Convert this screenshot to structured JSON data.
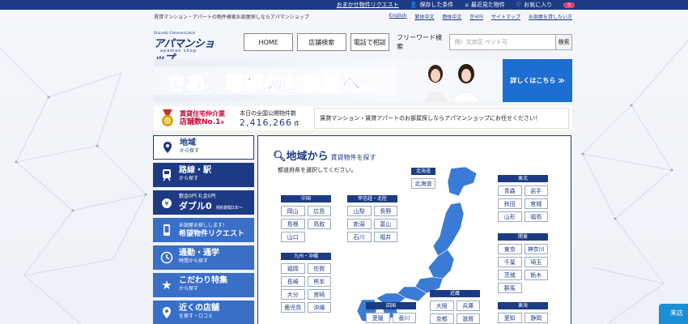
{
  "topbar": {
    "links": [
      "おまかせ物件リクエスト"
    ],
    "saved_conditions": "保存した条件",
    "recent": "最近見た物件",
    "favorites": "お気に入り",
    "fav_count": "0"
  },
  "subline": {
    "intro": "賃貸マンション・アパートの物件検索お部屋探しならアパマンショップ",
    "langs": [
      "English",
      "繁体中文",
      "簡体中文",
      "한국어",
      "サイトマップ",
      "お部屋を貸したい方"
    ]
  },
  "header": {
    "logo_small": "Dramatic Communication",
    "logo_main": "アパマンショップ",
    "logo_tag": "apaman shop",
    "nav": [
      "HOME",
      "店舗検索",
      "電話で相談"
    ],
    "freeword_label": "フリーワード検索",
    "search_placeholder": "例）文京区 ペット可",
    "search_button": "検索"
  },
  "banner": {
    "slogan": "さあ、理想のお部屋へ。",
    "cta": "詳しくはこちら ≫"
  },
  "info": {
    "no1_line1": "賃貸住宅仲介業",
    "no1_line2": "店舗数No.1",
    "no1_mark": "※",
    "count_label": "本日の全国公開物件数",
    "count_value": "2,416,266",
    "count_unit": "件",
    "message": "賃貸マンション・賃貸アパートのお部屋探しならアパマンショップにお任せください！"
  },
  "sidebar": [
    {
      "t1": "地域",
      "t2": "から探す",
      "icon": "map-pin-icon"
    },
    {
      "t1": "路線・駅",
      "t2": "から探す",
      "icon": "train-icon"
    },
    {
      "t1": "ダブル0",
      "t2": "敷金0円 礼金0円",
      "t3": "契約期間1年〜",
      "icon": "yen-bag-icon"
    },
    {
      "t1": "希望物件リクエスト",
      "t2": "お部屋お探しします！",
      "icon": "phone-icon"
    },
    {
      "t1": "通勤・通学",
      "t2": "時間から探す",
      "icon": "clock-icon"
    },
    {
      "t1": "こだわり特集",
      "t2": "から探す",
      "icon": "star-icon"
    },
    {
      "t1": "近くの店舗",
      "t2": "を探す・ロコミ",
      "icon": "pin-icon"
    }
  ],
  "panel": {
    "title": "地域から",
    "title_sub": "賃貸物件を探す",
    "note": "都道府県を選択してください。",
    "regions": {
      "hokkaido": {
        "name": "北海道",
        "prefs": [
          "北海道"
        ]
      },
      "tohoku": {
        "name": "東北",
        "prefs": [
          "青森",
          "岩手",
          "秋田",
          "宮城",
          "山形",
          "福島"
        ]
      },
      "chugoku": {
        "name": "中国",
        "prefs": [
          "岡山",
          "広島",
          "島根",
          "鳥取",
          "山口"
        ]
      },
      "koshinetsu": {
        "name": "甲信越・北陸",
        "prefs": [
          "山梨",
          "長野",
          "新潟",
          "富山",
          "石川",
          "福井"
        ]
      },
      "kanto": {
        "name": "関東",
        "prefs": [
          "東京",
          "神奈川",
          "千葉",
          "埼玉",
          "茨城",
          "栃木",
          "群馬"
        ]
      },
      "kyushu": {
        "name": "九州・沖縄",
        "prefs": [
          "福岡",
          "佐賀",
          "長崎",
          "熊本",
          "大分",
          "宮崎",
          "鹿児島",
          "沖縄"
        ]
      },
      "kinki": {
        "name": "近畿",
        "prefs": [
          "大阪",
          "兵庫",
          "京都",
          "滋賀"
        ]
      },
      "shikoku": {
        "name": "四国",
        "prefs": [
          "愛媛",
          "香川"
        ]
      },
      "tokai": {
        "name": "東海",
        "prefs": [
          "愛知",
          "静岡"
        ]
      }
    }
  },
  "sidetab": "来店"
}
